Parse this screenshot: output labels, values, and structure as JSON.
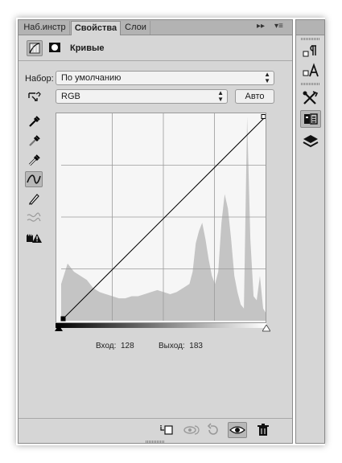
{
  "tabs": [
    {
      "label": "Наб.инстр",
      "active": false
    },
    {
      "label": "Свойства",
      "active": true
    },
    {
      "label": "Слои",
      "active": false
    }
  ],
  "tabbar_controls": {
    "collapse": "▸▸",
    "menu": "▾≡"
  },
  "header": {
    "title": "Кривые"
  },
  "preset": {
    "label": "Набор:",
    "value": "По умолчанию"
  },
  "channel": {
    "value": "RGB"
  },
  "auto_button": {
    "label": "Авто"
  },
  "tools": [
    "sample-in-image-icon",
    "black-point-eyedropper-icon",
    "gray-point-eyedropper-icon",
    "white-point-eyedropper-icon",
    "curve-points-icon",
    "pencil-icon",
    "smooth-icon",
    "clipping-warning-icon"
  ],
  "readout": {
    "input_label": "Вход:",
    "input_value": "128",
    "output_label": "Выход:",
    "output_value": "183"
  },
  "bottom_buttons": [
    "clip-to-layer-icon",
    "view-previous-icon",
    "reset-icon",
    "visibility-icon",
    "trash-icon"
  ],
  "dock_buttons": [
    "paragraph-style-icon",
    "character-style-icon",
    "tools-preset-icon",
    "properties-icon",
    "layers-icon"
  ],
  "colors": {
    "panel": "#d6d6d6",
    "tabbar": "#b3b3b3",
    "histogram": "#c4c4c4",
    "graph_bg": "#f6f6f6"
  },
  "chart_data": {
    "type": "area",
    "title": "",
    "xlim": [
      0,
      255
    ],
    "ylim": [
      0,
      100
    ],
    "grid": true,
    "histogram_x": [
      0,
      8,
      16,
      24,
      32,
      40,
      48,
      56,
      64,
      72,
      80,
      88,
      96,
      104,
      112,
      120,
      128,
      136,
      144,
      152,
      160,
      164,
      168,
      172,
      176,
      180,
      184,
      188,
      192,
      196,
      200,
      204,
      208,
      212,
      216,
      220,
      224,
      228,
      232,
      236,
      240,
      244,
      248,
      252,
      255
    ],
    "histogram_y": [
      18,
      28,
      24,
      22,
      20,
      16,
      14,
      13,
      12,
      11,
      11,
      12,
      12,
      13,
      14,
      15,
      14,
      13,
      14,
      16,
      18,
      24,
      38,
      44,
      48,
      40,
      30,
      22,
      18,
      24,
      48,
      62,
      55,
      40,
      22,
      14,
      8,
      6,
      100,
      40,
      12,
      10,
      22,
      6,
      4
    ],
    "curve_points": [
      [
        0,
        0
      ],
      [
        255,
        255
      ]
    ]
  }
}
